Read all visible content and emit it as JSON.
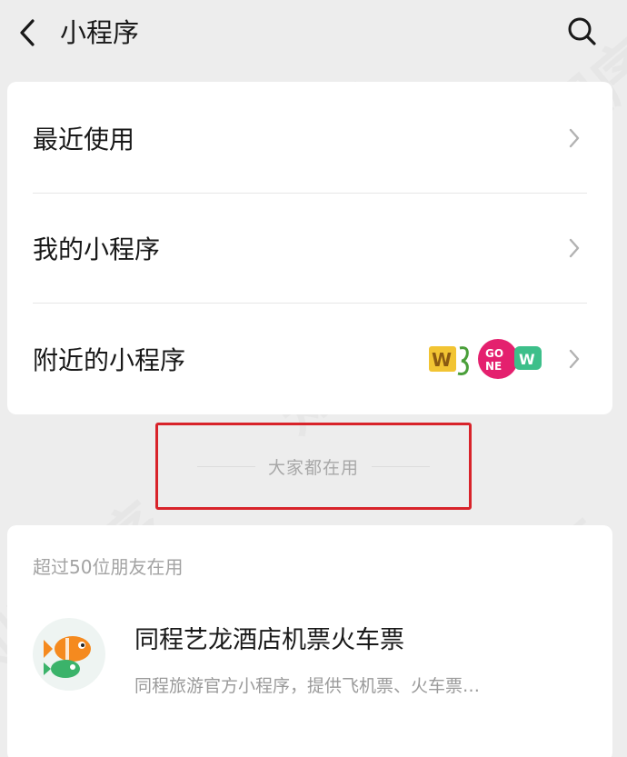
{
  "header": {
    "title": "小程序",
    "back_icon": "chevron-left-icon",
    "search_icon": "search-icon"
  },
  "menu": {
    "items": [
      {
        "label": "最近使用",
        "icon": "chevron-right-icon"
      },
      {
        "label": "我的小程序",
        "icon": "chevron-right-icon"
      },
      {
        "label": "附近的小程序",
        "icon": "chevron-right-icon",
        "preview_logos": [
          "wb-logo",
          "gone-logo",
          "w-badge-logo"
        ]
      }
    ]
  },
  "section": {
    "title": "大家都在用",
    "highlight_color": "#d8232a"
  },
  "popular": {
    "subtitle": "超过50位朋友在用",
    "apps": [
      {
        "name": "同程艺龙酒店机票火车票",
        "description": "同程旅游官方小程序，提供飞机票、火车票…",
        "logo": "tongcheng-fish-logo"
      }
    ]
  },
  "watermark_text": "知晓程序",
  "colors": {
    "background": "#ededed",
    "card": "#ffffff",
    "text_primary": "#191919",
    "text_secondary": "#a3a3a3"
  }
}
